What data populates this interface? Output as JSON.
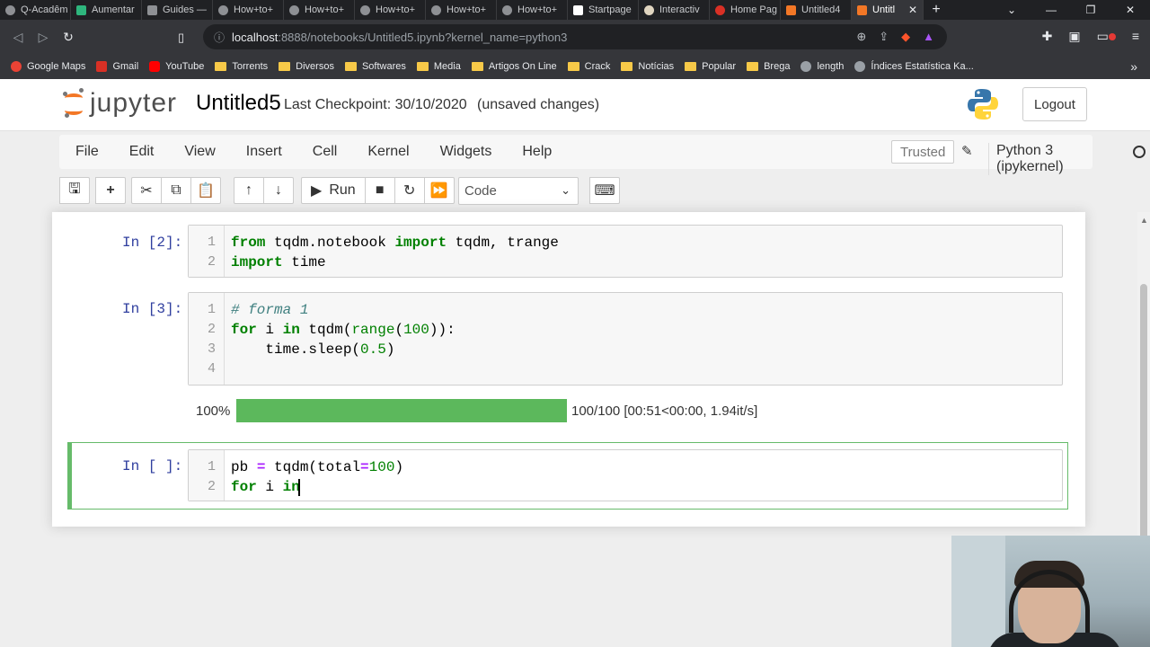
{
  "browser": {
    "tabs": [
      {
        "label": "Q-Acadêm"
      },
      {
        "label": "Aumentar"
      },
      {
        "label": "Guides —"
      },
      {
        "label": "How+to+"
      },
      {
        "label": "How+to+"
      },
      {
        "label": "How+to+"
      },
      {
        "label": "How+to+"
      },
      {
        "label": "How+to+"
      },
      {
        "label": "Startpage"
      },
      {
        "label": "Interactiv"
      },
      {
        "label": "Home Pag"
      },
      {
        "label": "Untitled4"
      },
      {
        "label": "Untitl"
      }
    ],
    "url_host": "localhost",
    "url_rest": ":8888/notebooks/Untitled5.ipynb?kernel_name=python3",
    "bookmarks": [
      "Google Maps",
      "Gmail",
      "YouTube",
      "Torrents",
      "Diversos",
      "Softwares",
      "Media",
      "Artigos On Line",
      "Crack",
      "Notícias",
      "Popular",
      "Brega",
      "length",
      "Índices Estatística Ka..."
    ]
  },
  "header": {
    "logo_text": "jupyter",
    "notebook_name": "Untitled5",
    "checkpoint": "Last Checkpoint: 30/10/2020",
    "unsaved": "(unsaved changes)",
    "logout": "Logout"
  },
  "menu": {
    "items": [
      "File",
      "Edit",
      "View",
      "Insert",
      "Cell",
      "Kernel",
      "Widgets",
      "Help"
    ],
    "trusted": "Trusted",
    "kernel": "Python 3 (ipykernel)"
  },
  "toolbar": {
    "run_label": "Run",
    "cell_type": "Code"
  },
  "cells": [
    {
      "prompt": "In [2]:",
      "lines": [
        "1",
        "2"
      ]
    },
    {
      "prompt": "In [3]:",
      "lines": [
        "1",
        "2",
        "3",
        "4"
      ],
      "output": {
        "percent_label": "100%",
        "progress": 1.0,
        "stats": "100/100 [00:51<00:00, 1.94it/s]"
      }
    },
    {
      "prompt": "In [ ]:",
      "lines": [
        "1",
        "2"
      ]
    }
  ],
  "code": {
    "c1_l1": [
      "from",
      " tqdm.notebook ",
      "import",
      " tqdm, trange"
    ],
    "c1_l2": [
      "import",
      " time"
    ],
    "c2_l1": "# forma 1",
    "c2_l2": [
      "for",
      " i ",
      "in",
      " tqdm(",
      "range",
      "(",
      "100",
      ")):"
    ],
    "c2_l3": [
      "    time.sleep(",
      "0.5",
      ")"
    ],
    "c3_l1": [
      "pb ",
      "=",
      " tqdm(total",
      "=",
      "100",
      ")"
    ],
    "c3_l2": [
      "for",
      " i ",
      "in"
    ]
  },
  "colors": {
    "progress_fill": "#5cb85c",
    "selected_border": "#66bb6a",
    "prompt": "#303f9f"
  }
}
